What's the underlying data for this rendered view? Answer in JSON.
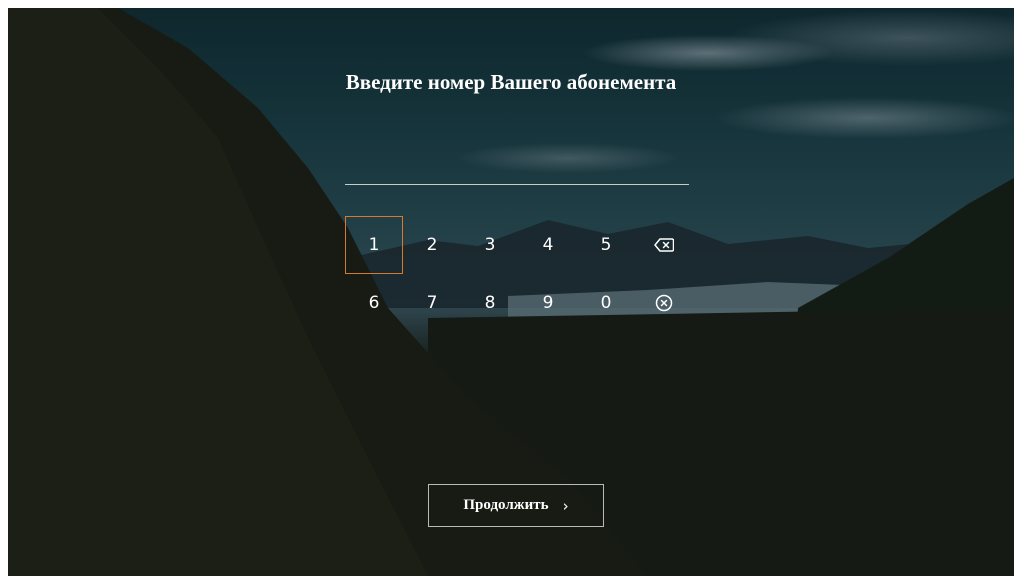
{
  "screen": {
    "title": "Введите номер Вашего абонемента",
    "entered_value": ""
  },
  "keypad": {
    "row1": [
      "1",
      "2",
      "3",
      "4",
      "5"
    ],
    "row2": [
      "6",
      "7",
      "8",
      "9",
      "0"
    ],
    "focused_key": "1",
    "backspace_icon": "backspace-icon",
    "clear_icon": "clear-circle-icon",
    "focus_color": "#d9782f"
  },
  "actions": {
    "continue_label": "Продолжить",
    "continue_icon": "chevron-right-icon"
  }
}
